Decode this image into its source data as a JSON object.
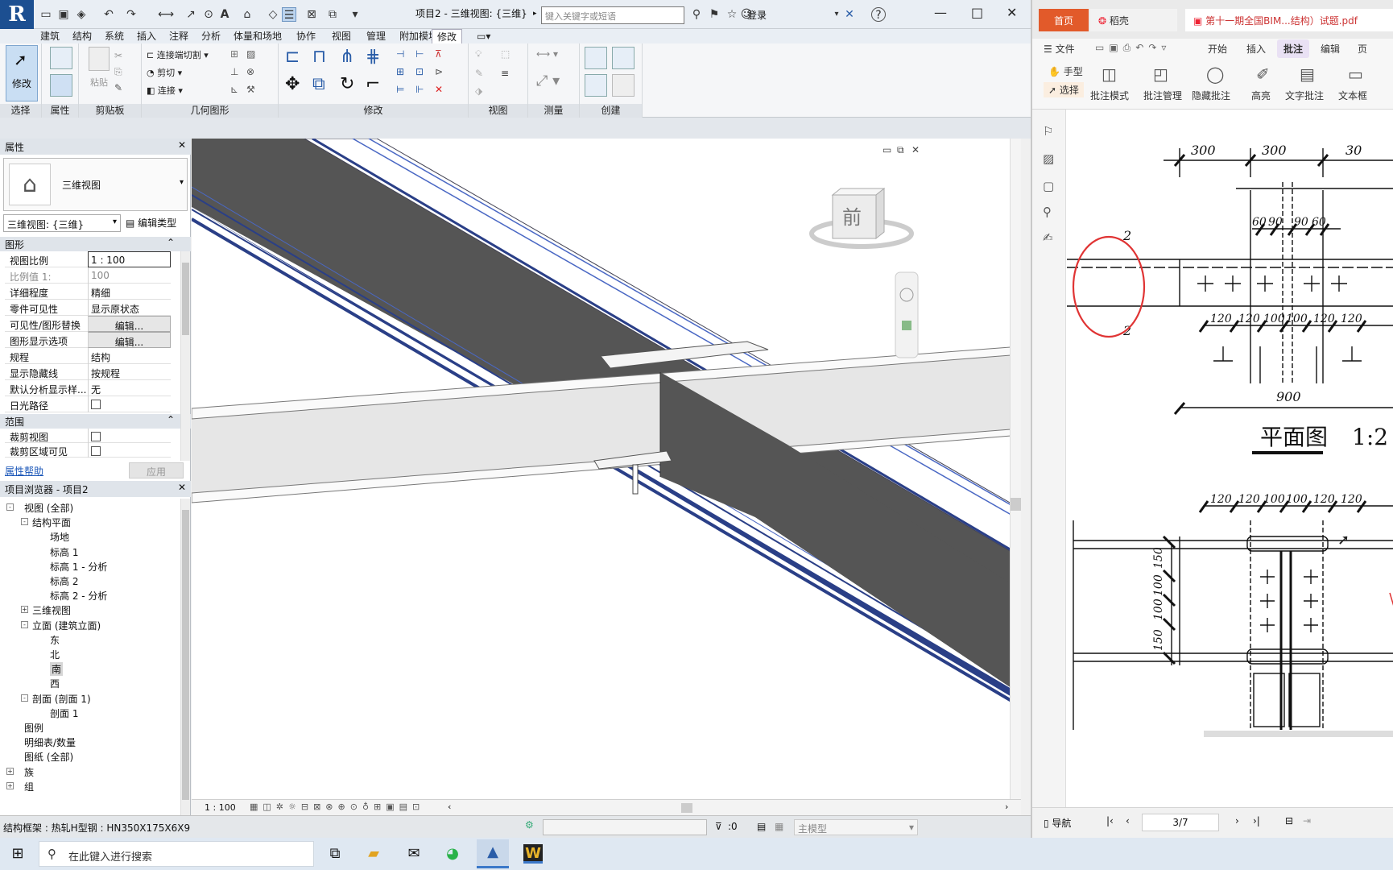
{
  "revit": {
    "window_title": "项目2 - 三维视图: {三维}",
    "search_placeholder": "键入关键字或短语",
    "login": "登录",
    "menu_tabs": [
      "建筑",
      "结构",
      "系统",
      "插入",
      "注释",
      "分析",
      "体量和场地",
      "协作",
      "视图",
      "管理",
      "附加模块",
      "修改"
    ],
    "ribbon": {
      "modify_label": "修改",
      "paste_label": "粘贴",
      "groups": [
        "选择",
        "属性",
        "剪贴板",
        "几何图形",
        "修改",
        "视图",
        "测量",
        "创建"
      ],
      "geom_buttons": [
        "连接端切割",
        "剪切",
        "连接"
      ]
    },
    "properties": {
      "title": "属性",
      "type_name": "三维视图",
      "view_selector": "三维视图: {三维}",
      "edit_type": "编辑类型",
      "section_graphics": "图形",
      "rows": [
        {
          "k": "视图比例",
          "v": "1 : 100"
        },
        {
          "k": "比例值 1:",
          "v": "100"
        },
        {
          "k": "详细程度",
          "v": "精细"
        },
        {
          "k": "零件可见性",
          "v": "显示原状态"
        },
        {
          "k": "可见性/图形替换",
          "v": "编辑..."
        },
        {
          "k": "图形显示选项",
          "v": "编辑..."
        },
        {
          "k": "规程",
          "v": "结构"
        },
        {
          "k": "显示隐藏线",
          "v": "按规程"
        },
        {
          "k": "默认分析显示样...",
          "v": "无"
        },
        {
          "k": "日光路径",
          "v": ""
        }
      ],
      "section_extent": "范围",
      "extent_rows": [
        {
          "k": "裁剪视图",
          "v": ""
        },
        {
          "k": "裁剪区域可见",
          "v": ""
        }
      ],
      "help": "属性帮助",
      "apply": "应用"
    },
    "browser": {
      "title": "项目浏览器 - 项目2",
      "items": [
        {
          "label": "视图 (全部)",
          "level": 0,
          "exp": "-"
        },
        {
          "label": "结构平面",
          "level": 1,
          "exp": "-"
        },
        {
          "label": "场地",
          "level": 2,
          "exp": ""
        },
        {
          "label": "标高 1",
          "level": 2,
          "exp": ""
        },
        {
          "label": "标高 1 - 分析",
          "level": 2,
          "exp": ""
        },
        {
          "label": "标高 2",
          "level": 2,
          "exp": ""
        },
        {
          "label": "标高 2 - 分析",
          "level": 2,
          "exp": ""
        },
        {
          "label": "三维视图",
          "level": 1,
          "exp": "+"
        },
        {
          "label": "立面 (建筑立面)",
          "level": 1,
          "exp": "-"
        },
        {
          "label": "东",
          "level": 2,
          "exp": ""
        },
        {
          "label": "北",
          "level": 2,
          "exp": ""
        },
        {
          "label": "南",
          "level": 2,
          "exp": ""
        },
        {
          "label": "西",
          "level": 2,
          "exp": ""
        },
        {
          "label": "剖面 (剖面 1)",
          "level": 1,
          "exp": "-"
        },
        {
          "label": "剖面 1",
          "level": 2,
          "exp": ""
        },
        {
          "label": "图例",
          "level": 0,
          "exp": ""
        },
        {
          "label": "明细表/数量",
          "level": 0,
          "exp": ""
        },
        {
          "label": "图纸 (全部)",
          "level": 0,
          "exp": ""
        },
        {
          "label": "族",
          "level": 0,
          "exp": "+"
        },
        {
          "label": "组",
          "level": 0,
          "exp": "+"
        }
      ]
    },
    "viewcube_face": "前",
    "view_scale": "1 : 100",
    "status": "结构框架 : 热轧H型钢 : HN350X175X6X9",
    "status_zero": ":0",
    "status_model": "主模型"
  },
  "pdf": {
    "tab_home": "首页",
    "tab_daoke": "稻壳",
    "tab_doc": "第十一期全国BIM...结构）试题.pdf",
    "menu": [
      "文件",
      "开始",
      "插入",
      "批注",
      "编辑",
      "页"
    ],
    "tools": [
      "手型",
      "选择",
      "批注模式",
      "批注管理",
      "隐藏批注",
      "高亮",
      "文字批注",
      "文本框"
    ],
    "drawing": {
      "top_dims": [
        "300",
        "300",
        "30"
      ],
      "dims_60_90": [
        "60",
        "90",
        "90",
        "60"
      ],
      "dims_120": [
        "120",
        "120",
        "100",
        "100",
        "120",
        "120"
      ],
      "dims_lower": [
        "120",
        "120",
        "100",
        "100",
        "120",
        "120"
      ],
      "vertical_dims": [
        "150",
        "100",
        "100",
        "150"
      ],
      "dim_900": "900",
      "section_mark": "2",
      "plan_title": "平面图",
      "plan_scale": "1:2"
    },
    "nav": "导航",
    "page": "3/7"
  },
  "taskbar": {
    "search": "在此键入进行搜索"
  }
}
